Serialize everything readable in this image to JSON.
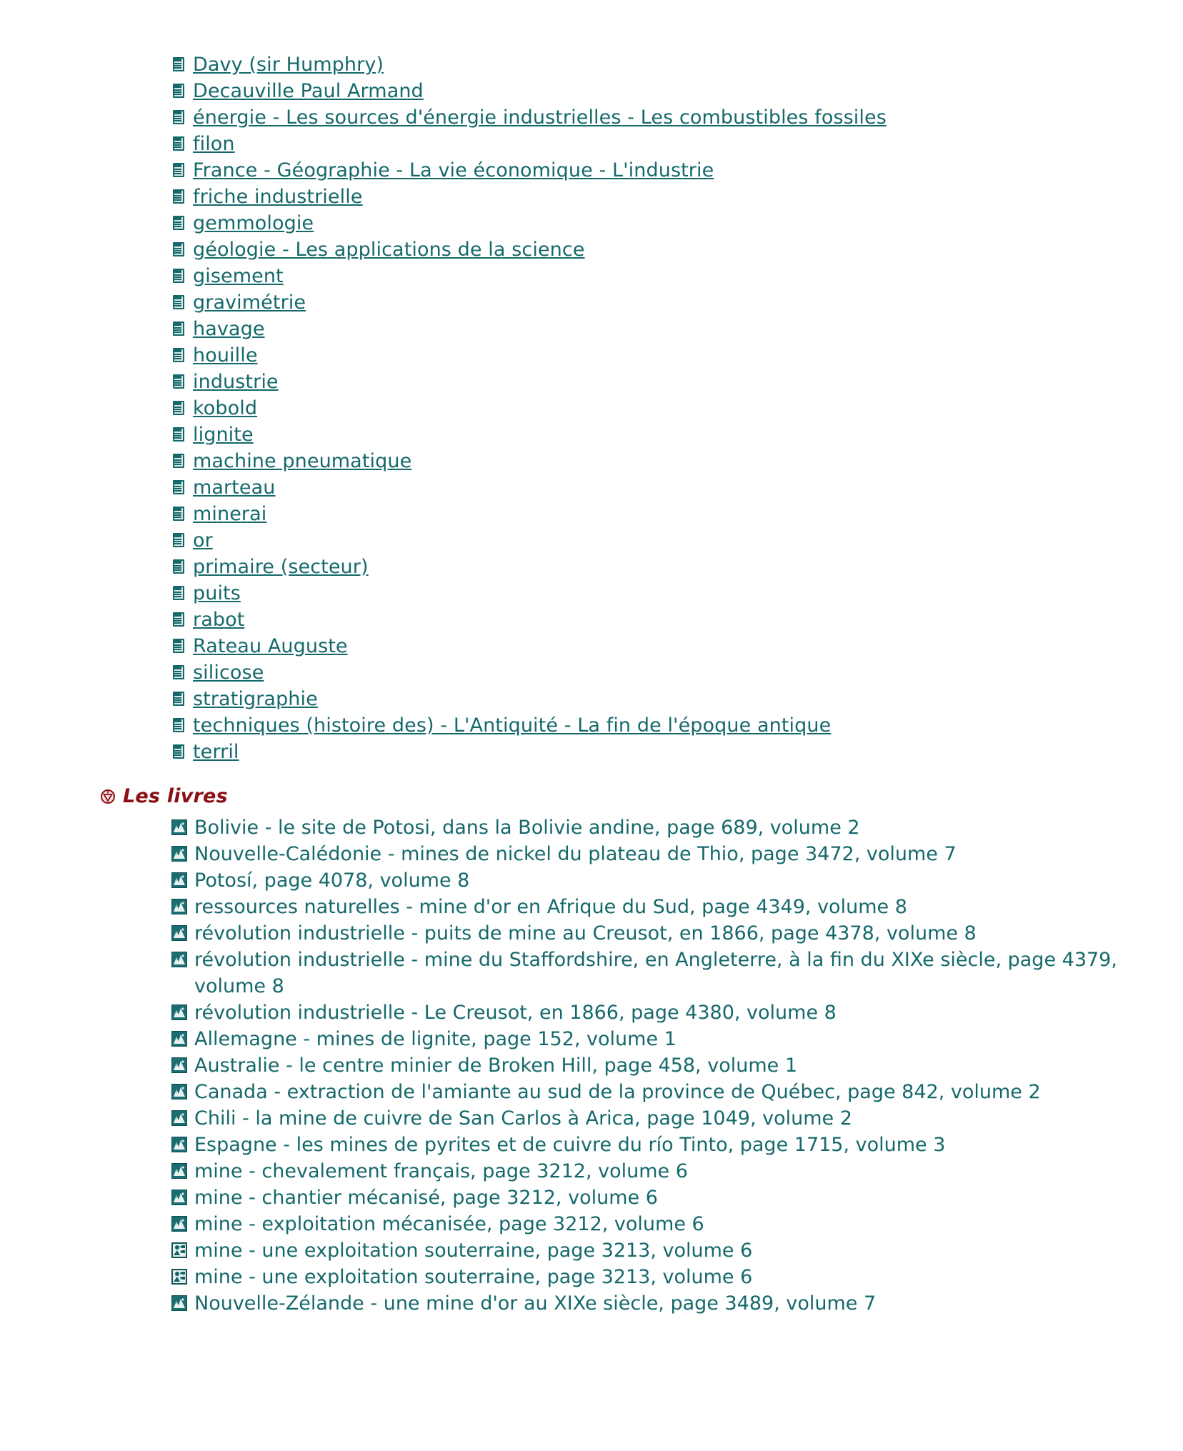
{
  "articles": {
    "icon": "document-icon",
    "items": [
      "Davy (sir Humphry)",
      "Decauville Paul Armand",
      "énergie - Les sources d'énergie industrielles - Les combustibles fossiles",
      "filon",
      "France - Géographie - La vie économique - L'industrie",
      "friche industrielle",
      "gemmologie",
      "géologie - Les applications de la science",
      "gisement",
      "gravimétrie",
      "havage",
      "houille",
      "industrie",
      "kobold",
      "lignite",
      "machine pneumatique",
      "marteau",
      "minerai",
      "or",
      "primaire (secteur)",
      "puits",
      "rabot",
      "Rateau Auguste",
      "silicose",
      "stratigraphie",
      "techniques (histoire des) - L'Antiquité - La fin de l'époque antique",
      "terril"
    ]
  },
  "books_section": {
    "heading": "Les livres",
    "heading_icon": "target-icon",
    "heading_color": "#8c0f16",
    "items": [
      {
        "icon": "photo-icon",
        "text": "Bolivie - le site de Potosi, dans la Bolivie andine, page 689, volume 2"
      },
      {
        "icon": "photo-icon",
        "text": "Nouvelle-Calédonie - mines de nickel du plateau de Thio, page 3472, volume 7"
      },
      {
        "icon": "photo-icon",
        "text": "Potosí, page 4078, volume 8"
      },
      {
        "icon": "photo-icon",
        "text": "ressources naturelles - mine d'or en Afrique du Sud, page 4349, volume 8"
      },
      {
        "icon": "photo-icon",
        "text": "révolution industrielle - puits de mine au Creusot, en 1866, page 4378, volume 8"
      },
      {
        "icon": "photo-icon",
        "text": "révolution industrielle - mine du Staffordshire, en Angleterre, à la fin du XIXe siècle, page 4379, volume 8"
      },
      {
        "icon": "photo-icon",
        "text": "révolution industrielle - Le Creusot, en 1866, page 4380, volume 8"
      },
      {
        "icon": "photo-icon",
        "text": "Allemagne - mines de lignite, page 152, volume 1"
      },
      {
        "icon": "photo-icon",
        "text": "Australie - le centre minier de Broken Hill, page 458, volume 1"
      },
      {
        "icon": "photo-icon",
        "text": "Canada - extraction de l'amiante au sud de la province de Québec, page 842, volume 2"
      },
      {
        "icon": "photo-icon",
        "text": "Chili - la mine de cuivre de San Carlos à Arica, page 1049, volume 2"
      },
      {
        "icon": "photo-icon",
        "text": "Espagne - les mines de pyrites et de cuivre du río Tinto, page 1715, volume 3"
      },
      {
        "icon": "photo-icon",
        "text": "mine - chevalement français, page 3212, volume 6"
      },
      {
        "icon": "photo-icon",
        "text": "mine - chantier mécanisé, page 3212, volume 6"
      },
      {
        "icon": "photo-icon",
        "text": "mine - exploitation mécanisée, page 3212, volume 6"
      },
      {
        "icon": "diagram-icon",
        "text": "mine - une exploitation souterraine, page 3213, volume 6"
      },
      {
        "icon": "diagram-icon",
        "text": "mine - une exploitation souterraine, page 3213, volume 6"
      },
      {
        "icon": "photo-icon",
        "text": "Nouvelle-Zélande - une mine d'or au XIXe siècle, page 3489, volume 7"
      }
    ]
  },
  "colors": {
    "link": "#16696b",
    "heading": "#8c0f16",
    "background": "#ffffff"
  }
}
